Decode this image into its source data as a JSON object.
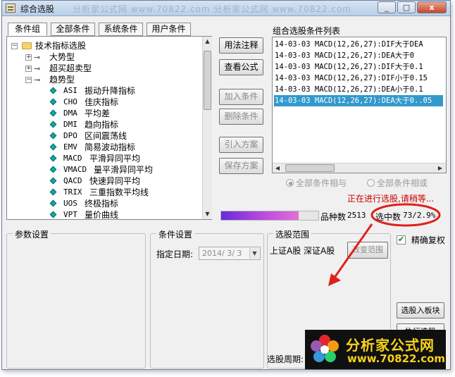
{
  "window": {
    "title": "综合选股",
    "watermark": "分析家公式网 www.70822.com 分析家公式网 www.70822.com",
    "min_label": "_",
    "max_label": "□",
    "close_label": "x"
  },
  "tabs": [
    {
      "label": "条件组",
      "active": true
    },
    {
      "label": "全部条件",
      "active": false
    },
    {
      "label": "系统条件",
      "active": false
    },
    {
      "label": "用户条件",
      "active": false
    }
  ],
  "tree": {
    "root": "技术指标选股",
    "groups": [
      "大势型",
      "超买超卖型",
      "趋势型"
    ],
    "items": [
      {
        "code": "ASI",
        "name": "振动升降指标"
      },
      {
        "code": "CHO",
        "name": "佳庆指标"
      },
      {
        "code": "DMA",
        "name": "平均差"
      },
      {
        "code": "DMI",
        "name": "趋向指标"
      },
      {
        "code": "DPO",
        "name": "区间震荡线"
      },
      {
        "code": "EMV",
        "name": "简易波动指标"
      },
      {
        "code": "MACD",
        "name": "平滑异同平均"
      },
      {
        "code": "VMACD",
        "name": "量平滑异同平均"
      },
      {
        "code": "QACD",
        "name": "快速异同平均"
      },
      {
        "code": "TRIX",
        "name": "三重指数平均线"
      },
      {
        "code": "UOS",
        "name": "终极指标"
      },
      {
        "code": "VPT",
        "name": "量价曲线"
      }
    ]
  },
  "buttons": {
    "usage": "用法注释",
    "view_formula": "查看公式",
    "add_condition": "加入条件",
    "delete_condition": "删除条件",
    "import_plan": "引入方案",
    "save_plan": "保存方案",
    "change_range": "改变范围",
    "add_to_board": "选股入板块",
    "execute": "执行选股"
  },
  "conditions": {
    "title": "组合选股条件列表",
    "items": [
      "14-03-03 MACD(12,26,27):DIF大于DEA",
      "14-03-03 MACD(12,26,27):DEA大于0",
      "14-03-03 MACD(12,26,27):DIF大于0.1",
      "14-03-03 MACD(12,26,27):DIF小于0.15",
      "14-03-03 MACD(12,26,27):DEA小于0.1",
      "14-03-03 MACD(12,26,27):DEA大于0..05"
    ],
    "selected_index": 5
  },
  "logic": {
    "and_label": "全部条件相与",
    "or_label": "全部条件相或"
  },
  "status": {
    "message": "正在进行选股,请稍等...",
    "progress": 0.8,
    "count_label": "品种数",
    "count_value": "2513",
    "selected_label": "选中数",
    "selected_value": "73/2.9%"
  },
  "params": {
    "title": "参数设置"
  },
  "condition_settings": {
    "title": "条件设置",
    "date_label": "指定日期:",
    "date_value": "2014/ 3/ 3"
  },
  "range": {
    "title": "选股范围",
    "value": "上证A股 深证A股"
  },
  "period": {
    "label": "选股周期:"
  },
  "exact_restore": {
    "label": "精确复权",
    "checked": true
  },
  "logo": {
    "title": "分析家公式网",
    "url": "www.70822.com"
  },
  "colors": {
    "selection": "#3399cc",
    "status_text": "#cc0000",
    "annotation": "#e0201b",
    "logo_text": "#f6d21c"
  }
}
